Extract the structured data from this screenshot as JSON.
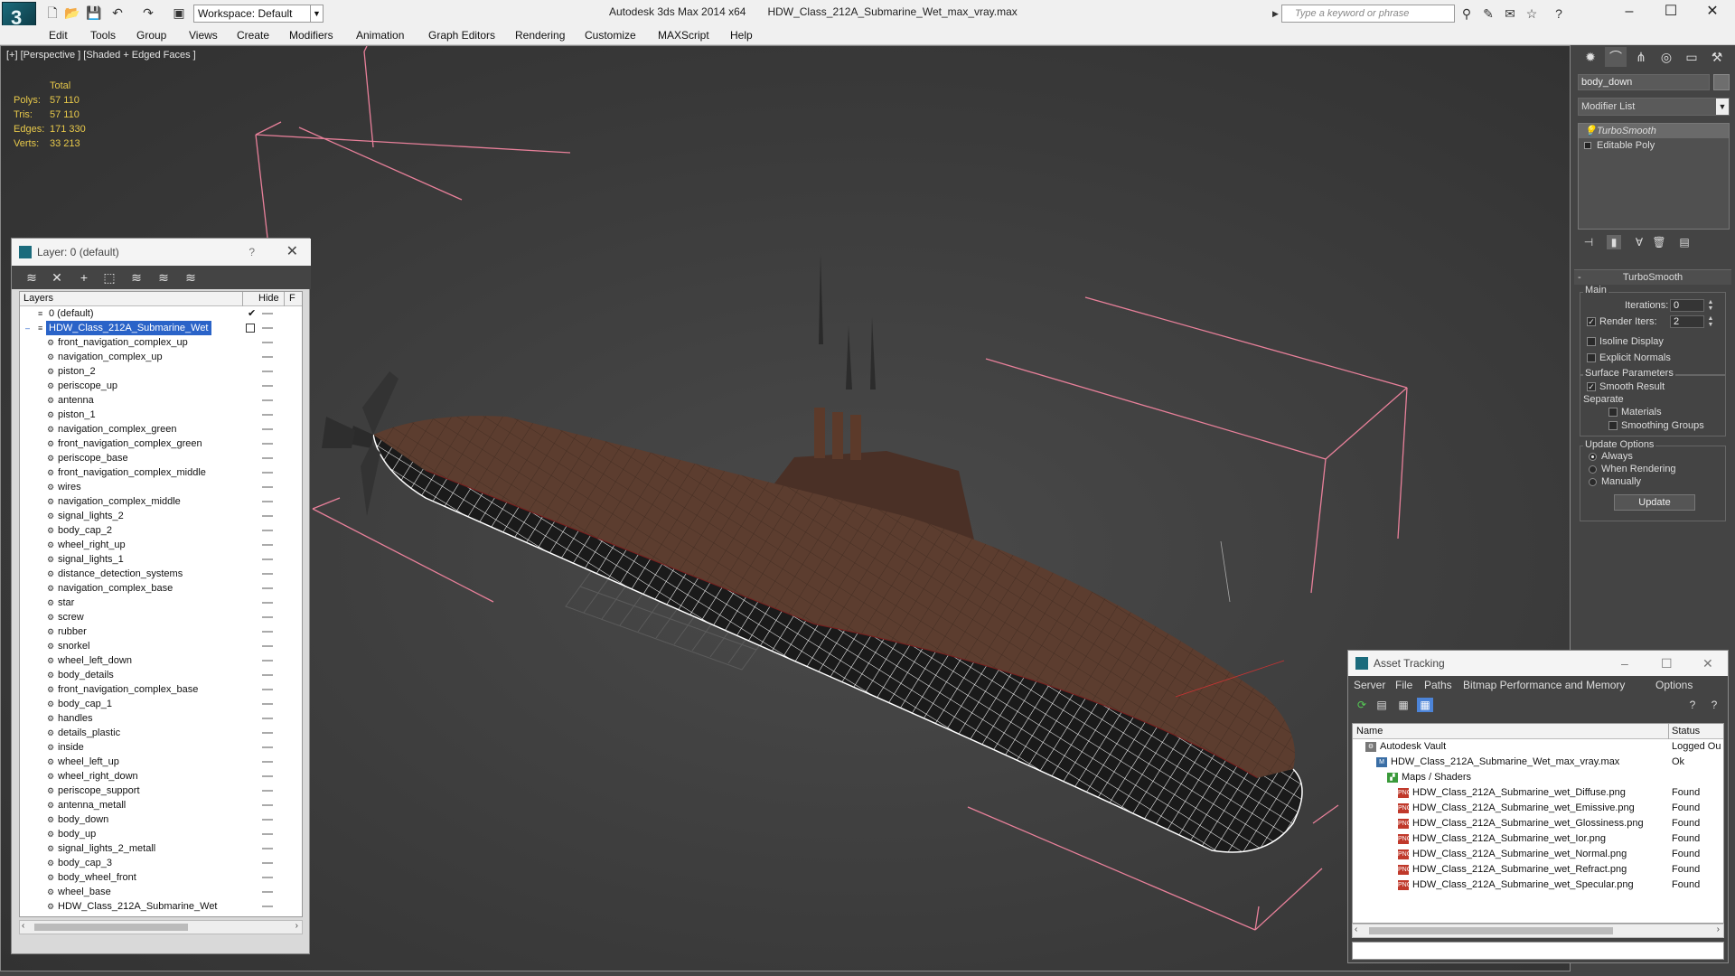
{
  "app": {
    "title": "Autodesk 3ds Max 2014 x64",
    "file": "HDW_Class_212A_Submarine_Wet_max_vray.max",
    "logo": "3",
    "workspace": "Workspace: Default",
    "search_placeholder": "Type a keyword or phrase"
  },
  "menu": [
    "Edit",
    "Tools",
    "Group",
    "Views",
    "Create",
    "Modifiers",
    "Animation",
    "Graph Editors",
    "Rendering",
    "Customize",
    "MAXScript",
    "Help"
  ],
  "viewport": {
    "label": "[+] [Perspective ] [Shaded + Edged Faces ]",
    "stats_header": "Total",
    "stats": [
      {
        "key": "Polys:",
        "value": "57 110"
      },
      {
        "key": "Tris:",
        "value": "57 110"
      },
      {
        "key": "Edges:",
        "value": "171 330"
      },
      {
        "key": "Verts:",
        "value": "33 213"
      }
    ],
    "colors": {
      "hull": "#5c3d2f",
      "wire": "#ffffff",
      "bbox": "#e8809a"
    }
  },
  "layer_window": {
    "title": "Layer: 0 (default)",
    "help": "?",
    "columns": [
      "Layers",
      "Hide",
      "F"
    ],
    "default_layer": "0 (default)",
    "selected_layer": "HDW_Class_212A_Submarine_Wet",
    "objects": [
      "front_navigation_complex_up",
      "navigation_complex_up",
      "piston_2",
      "periscope_up",
      "antenna",
      "piston_1",
      "navigation_complex_green",
      "front_navigation_complex_green",
      "periscope_base",
      "front_navigation_complex_middle",
      "wires",
      "navigation_complex_middle",
      "signal_lights_2",
      "body_cap_2",
      "wheel_right_up",
      "signal_lights_1",
      "distance_detection_systems",
      "navigation_complex_base",
      "star",
      "screw",
      "rubber",
      "snorkel",
      "wheel_left_down",
      "body_details",
      "front_navigation_complex_base",
      "body_cap_1",
      "handles",
      "details_plastic",
      "inside",
      "wheel_left_up",
      "wheel_right_down",
      "periscope_support",
      "antenna_metall",
      "body_down",
      "body_up",
      "signal_lights_2_metall",
      "body_cap_3",
      "body_wheel_front",
      "wheel_base",
      "HDW_Class_212A_Submarine_Wet"
    ]
  },
  "command_panel": {
    "object_name": "body_down",
    "modifier_list": "Modifier List",
    "stack": [
      "TurboSmooth",
      "Editable Poly"
    ],
    "turbosmooth": {
      "title": "TurboSmooth",
      "main": "Main",
      "iterations_label": "Iterations:",
      "iterations": "0",
      "render_iters_label": "Render Iters:",
      "render_iters": "2",
      "isoline": "Isoline Display",
      "explicit": "Explicit Normals",
      "surface": "Surface Parameters",
      "smooth_result": "Smooth Result",
      "separate": "Separate",
      "materials": "Materials",
      "smoothing_groups": "Smoothing Groups",
      "update_options": "Update Options",
      "always": "Always",
      "when_rendering": "When Rendering",
      "manually": "Manually",
      "update": "Update"
    }
  },
  "asset_window": {
    "title": "Asset Tracking",
    "menu": [
      "Server",
      "File",
      "Paths",
      "Bitmap Performance and Memory",
      "Options"
    ],
    "columns": [
      "Name",
      "Status"
    ],
    "rows": [
      {
        "name": "Autodesk Vault",
        "status": "Logged Ou",
        "indent": 0,
        "icon": "vault-icon"
      },
      {
        "name": "HDW_Class_212A_Submarine_Wet_max_vray.max",
        "status": "Ok",
        "indent": 1,
        "icon": "max-file-icon"
      },
      {
        "name": "Maps / Shaders",
        "status": "",
        "indent": 2,
        "icon": "maps-icon"
      },
      {
        "name": "HDW_Class_212A_Submarine_wet_Diffuse.png",
        "status": "Found",
        "indent": 3,
        "icon": "png-icon"
      },
      {
        "name": "HDW_Class_212A_Submarine_wet_Emissive.png",
        "status": "Found",
        "indent": 3,
        "icon": "png-icon"
      },
      {
        "name": "HDW_Class_212A_Submarine_wet_Glossiness.png",
        "status": "Found",
        "indent": 3,
        "icon": "png-icon"
      },
      {
        "name": "HDW_Class_212A_Submarine_wet_Ior.png",
        "status": "Found",
        "indent": 3,
        "icon": "png-icon"
      },
      {
        "name": "HDW_Class_212A_Submarine_wet_Normal.png",
        "status": "Found",
        "indent": 3,
        "icon": "png-icon"
      },
      {
        "name": "HDW_Class_212A_Submarine_wet_Refract.png",
        "status": "Found",
        "indent": 3,
        "icon": "png-icon"
      },
      {
        "name": "HDW_Class_212A_Submarine_wet_Specular.png",
        "status": "Found",
        "indent": 3,
        "icon": "png-icon"
      }
    ]
  }
}
